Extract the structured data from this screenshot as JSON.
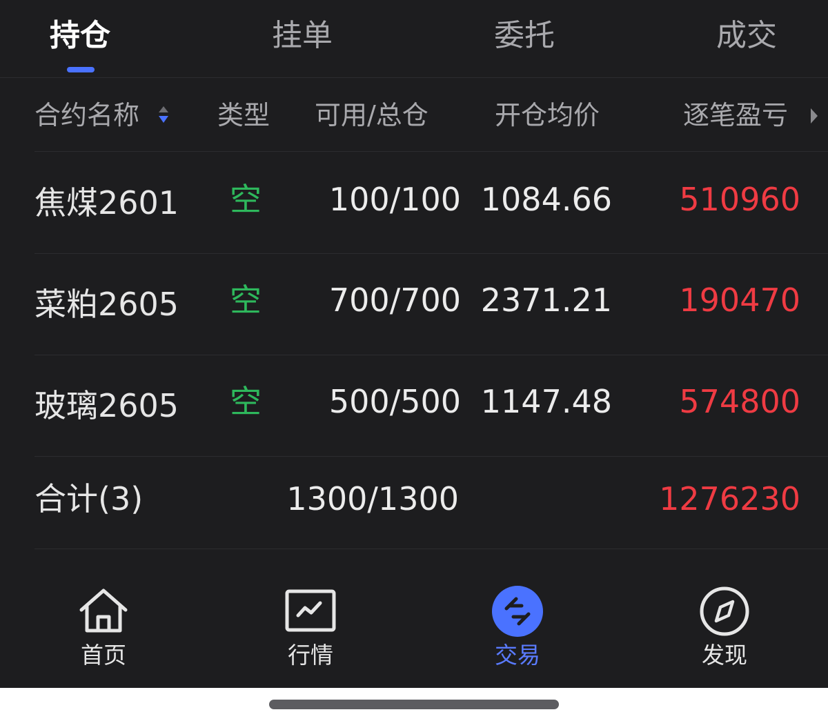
{
  "tabs": [
    {
      "label": "持仓",
      "active": true
    },
    {
      "label": "挂单",
      "active": false
    },
    {
      "label": "委托",
      "active": false
    },
    {
      "label": "成交",
      "active": false
    }
  ],
  "columns": {
    "name": "合约名称",
    "type": "类型",
    "qty": "可用/总仓",
    "avg": "开仓均价",
    "pnl": "逐笔盈亏"
  },
  "rows": [
    {
      "name": "焦煤2601",
      "type": "空",
      "qty": "100/100",
      "avg": "1084.66",
      "pnl": "510960"
    },
    {
      "name": "菜粕2605",
      "type": "空",
      "qty": "700/700",
      "avg": "2371.21",
      "pnl": "190470"
    },
    {
      "name": "玻璃2605",
      "type": "空",
      "qty": "500/500",
      "avg": "1147.48",
      "pnl": "574800"
    }
  ],
  "total": {
    "label": "合计(3)",
    "qty": "1300/1300",
    "pnl": "1276230"
  },
  "nav": [
    {
      "label": "首页",
      "icon": "home-icon",
      "active": false
    },
    {
      "label": "行情",
      "icon": "chart-icon",
      "active": false
    },
    {
      "label": "交易",
      "icon": "trade-icon",
      "active": true
    },
    {
      "label": "发现",
      "icon": "compass-icon",
      "active": false
    }
  ],
  "colors": {
    "background": "#1d1d1f",
    "accent": "#4a72ff",
    "short": "#2eb85c",
    "profit": "#ef3b43"
  }
}
